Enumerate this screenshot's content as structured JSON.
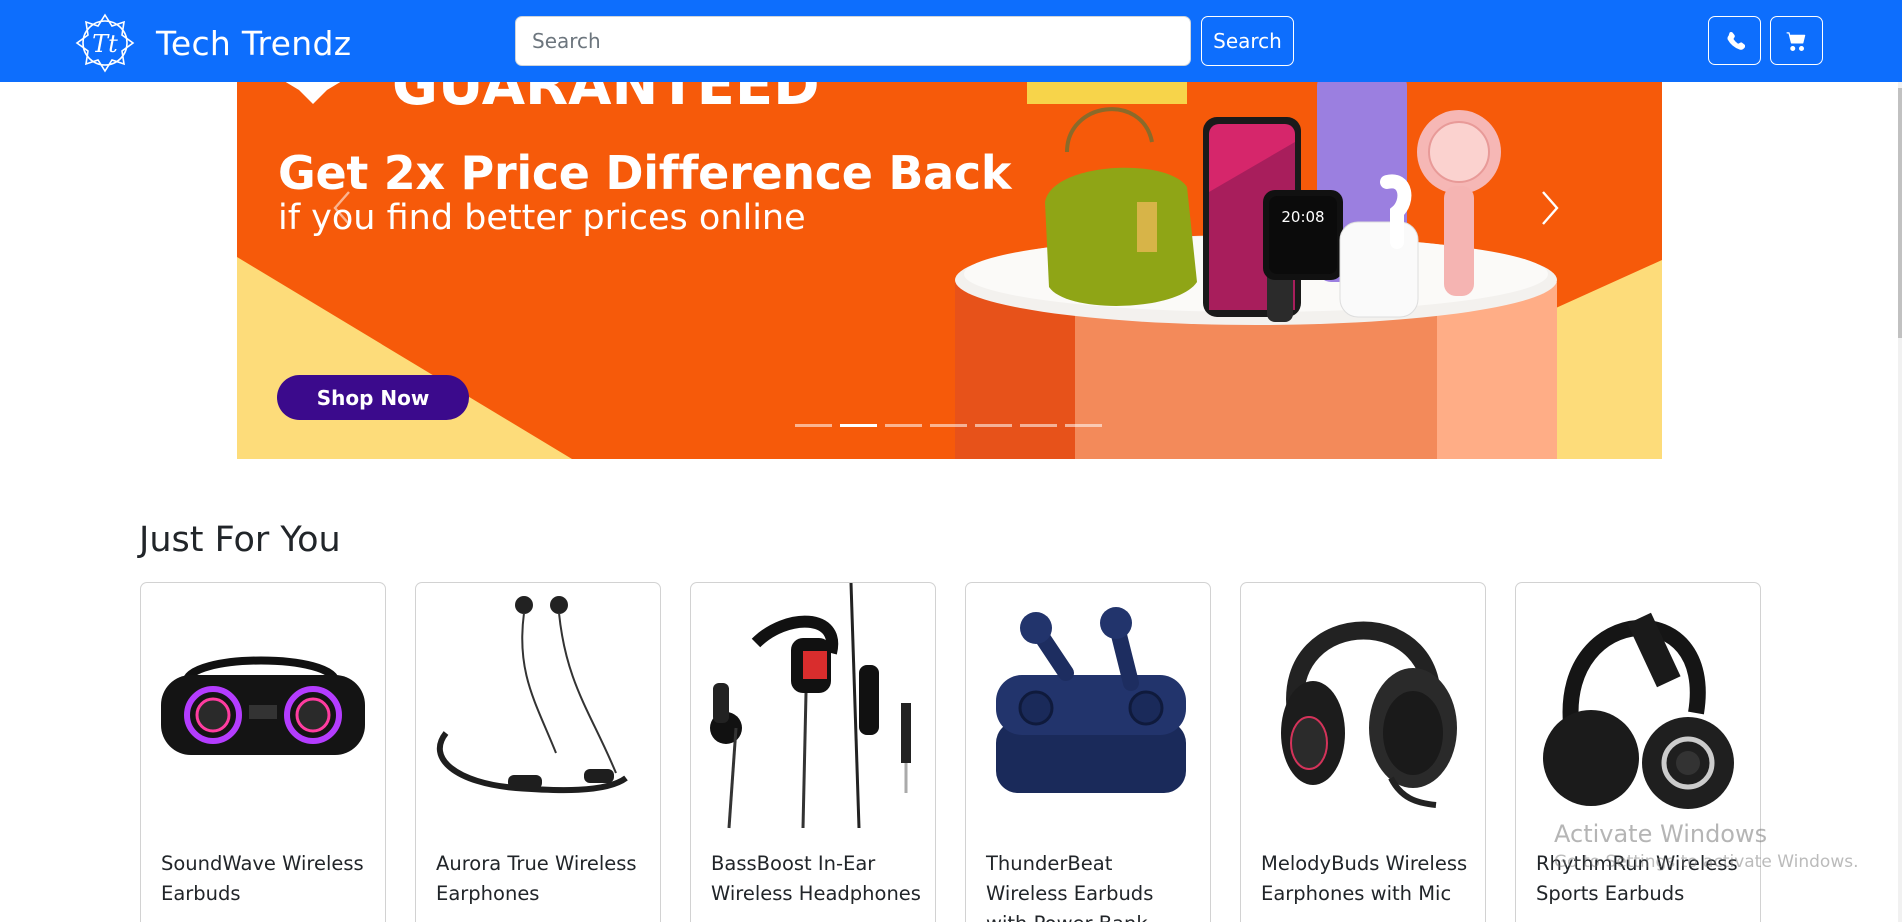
{
  "nav": {
    "brand_name": "Tech Trendz",
    "logo_text": "Tt",
    "search_placeholder": "Search",
    "search_value": "",
    "search_button": "Search",
    "phone_icon": "phone-icon",
    "cart_icon": "cart-icon",
    "accent_color": "#0d6efd"
  },
  "carousel": {
    "headline_partial": "GUARANTEED",
    "headline": "Get 2x Price Difference Back",
    "subline": "if you find better prices online",
    "cta": "Shop Now",
    "watch_time": "20:08",
    "slide_count": 7,
    "active_slide": 2,
    "prev_icon": "chevron-left-icon",
    "next_icon": "chevron-right-icon",
    "background_color": "#f65a0a",
    "cta_color": "#3b0a8c"
  },
  "section": {
    "title": "Just For You"
  },
  "products": [
    {
      "name": "SoundWave Wireless Earbuds"
    },
    {
      "name": "Aurora True Wireless Earphones"
    },
    {
      "name": "BassBoost In-Ear Wireless Headphones"
    },
    {
      "name": "ThunderBeat Wireless Earbuds with Power Bank"
    },
    {
      "name": "MelodyBuds Wireless Earphones with Mic"
    },
    {
      "name": "RhythmRun Wireless Sports Earbuds"
    }
  ],
  "watermark": {
    "line1": "Activate Windows",
    "line2": "Go to Settings to activate Windows."
  }
}
